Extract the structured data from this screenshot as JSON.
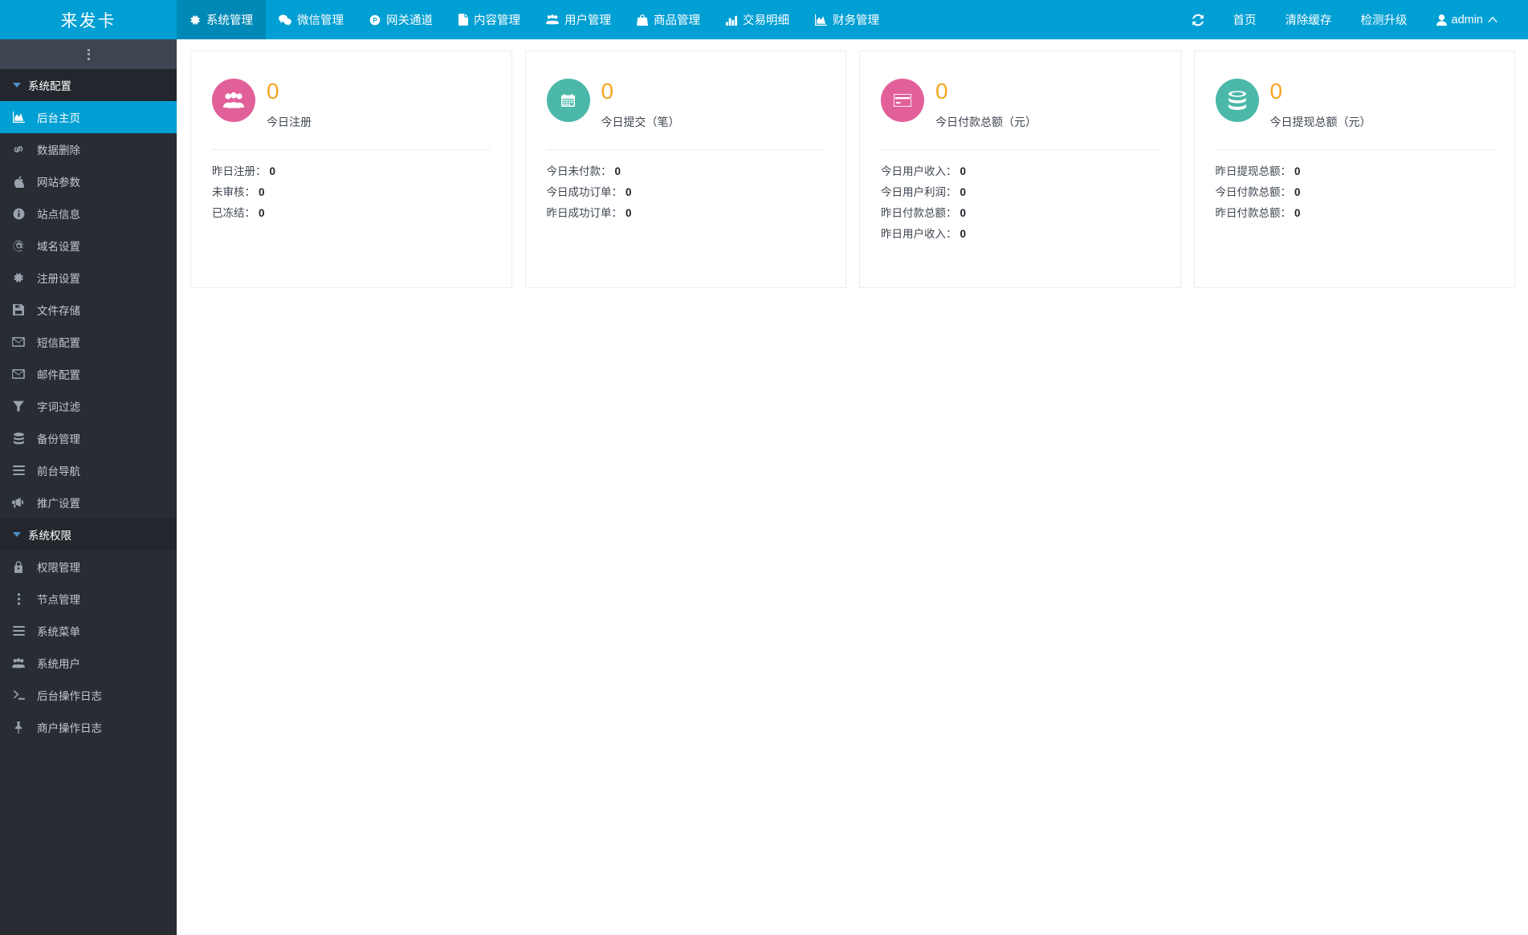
{
  "header": {
    "logo": "来发卡",
    "nav": [
      {
        "label": "系统管理",
        "icon": "gear-icon",
        "active": true
      },
      {
        "label": "微信管理",
        "icon": "wechat-icon",
        "active": false
      },
      {
        "label": "网关通道",
        "icon": "paypal-circle-icon",
        "active": false
      },
      {
        "label": "内容管理",
        "icon": "file-text-icon",
        "active": false
      },
      {
        "label": "用户管理",
        "icon": "users-icon",
        "active": false
      },
      {
        "label": "商品管理",
        "icon": "bag-icon",
        "active": false
      },
      {
        "label": "交易明细",
        "icon": "bar-chart-icon",
        "active": false
      },
      {
        "label": "财务管理",
        "icon": "area-chart-icon",
        "active": false
      }
    ],
    "right": [
      {
        "label": "",
        "icon": "refresh-icon"
      },
      {
        "label": "首页",
        "icon": ""
      },
      {
        "label": "清除缓存",
        "icon": ""
      },
      {
        "label": "检测升级",
        "icon": ""
      },
      {
        "label": "admin",
        "icon": "user-icon",
        "caret": "chevron-up-icon"
      }
    ]
  },
  "sidebar": {
    "collapse_icon": "vertical-ellipsis-icon",
    "groups": [
      {
        "label": "系统配置",
        "items": [
          {
            "label": "后台主页",
            "icon": "area-chart-icon",
            "active": true
          },
          {
            "label": "数据删除",
            "icon": "link-chain-icon",
            "active": false
          },
          {
            "label": "网站参数",
            "icon": "apple-icon",
            "active": false
          },
          {
            "label": "站点信息",
            "icon": "info-circle-icon",
            "active": false
          },
          {
            "label": "域名设置",
            "icon": "at-circle-icon",
            "active": false
          },
          {
            "label": "注册设置",
            "icon": "gear-icon",
            "active": false
          },
          {
            "label": "文件存储",
            "icon": "save-floppy-icon",
            "active": false
          },
          {
            "label": "短信配置",
            "icon": "envelope-icon",
            "active": false
          },
          {
            "label": "邮件配置",
            "icon": "envelope-icon",
            "active": false
          },
          {
            "label": "字词过滤",
            "icon": "filter-icon",
            "active": false
          },
          {
            "label": "备份管理",
            "icon": "database-icon",
            "active": false
          },
          {
            "label": "前台导航",
            "icon": "list-bars-icon",
            "active": false
          },
          {
            "label": "推广设置",
            "icon": "megaphone-icon",
            "active": false
          }
        ]
      },
      {
        "label": "系统权限",
        "items": [
          {
            "label": "权限管理",
            "icon": "lock-icon",
            "active": false
          },
          {
            "label": "节点管理",
            "icon": "vertical-ellipsis-icon",
            "active": false
          },
          {
            "label": "系统菜单",
            "icon": "list-bars-icon",
            "active": false
          },
          {
            "label": "系统用户",
            "icon": "users-icon",
            "active": false
          },
          {
            "label": "后台操作日志",
            "icon": "terminal-icon",
            "active": false
          },
          {
            "label": "商户操作日志",
            "icon": "thumbtack-icon",
            "active": false
          }
        ]
      }
    ]
  },
  "cards": [
    {
      "icon": "users-icon",
      "icon_color": "#e2609a",
      "value": "0",
      "title": "今日注册",
      "rows": [
        {
          "label": "昨日注册：",
          "value": "0"
        },
        {
          "label": "未审核：",
          "value": "0"
        },
        {
          "label": "已冻结：",
          "value": "0"
        }
      ]
    },
    {
      "icon": "calendar-icon",
      "icon_color": "#4bb8a9",
      "value": "0",
      "title": "今日提交（笔）",
      "rows": [
        {
          "label": "今日未付款：",
          "value": "0"
        },
        {
          "label": "今日成功订单：",
          "value": "0"
        },
        {
          "label": "昨日成功订单：",
          "value": "0"
        }
      ]
    },
    {
      "icon": "credit-card-icon",
      "icon_color": "#e2609a",
      "value": "0",
      "title": "今日付款总额（元）",
      "rows": [
        {
          "label": "今日用户收入：",
          "value": "0"
        },
        {
          "label": "今日用户利润：",
          "value": "0"
        },
        {
          "label": "昨日付款总额：",
          "value": "0"
        },
        {
          "label": "昨日用户收入：",
          "value": "0"
        }
      ]
    },
    {
      "icon": "database-icon",
      "icon_color": "#4bb8a9",
      "value": "0",
      "title": "今日提现总额（元）",
      "rows": [
        {
          "label": "昨日提现总额：",
          "value": "0"
        },
        {
          "label": "今日付款总额：",
          "value": "0"
        },
        {
          "label": "昨日付款总额：",
          "value": "0"
        }
      ]
    }
  ],
  "colors": {
    "brand": "#009fd4",
    "brand_dark": "#0089b6",
    "sidebar_bg": "#282d33",
    "sidebar_group_bg": "#23272d",
    "accent_value": "#f5a623",
    "pink": "#e2609a",
    "teal": "#4bb8a9"
  }
}
